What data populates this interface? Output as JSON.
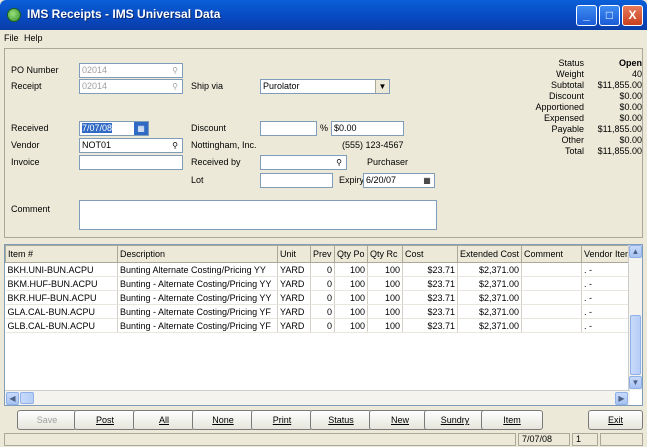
{
  "window": {
    "title": "IMS Receipts - IMS Universal Data",
    "minimize": "_",
    "maximize": "□",
    "close": "X"
  },
  "menu": [
    "File",
    "Help"
  ],
  "form": {
    "po_number_label": "PO Number",
    "po_number": "02014",
    "receipt_label": "Receipt",
    "receipt": "02014",
    "ship_via_label": "Ship via",
    "ship_via": "Purolator",
    "received_label": "Received",
    "received": "7/07/08",
    "discount_label": "Discount",
    "discount_pct": "",
    "pct_sign": "%",
    "discount_amount": "$0.00",
    "vendor_label": "Vendor",
    "vendor": "NOT01",
    "vendor_name": "Nottingham, Inc.",
    "vendor_phone": "(555) 123-4567",
    "invoice_label": "Invoice",
    "invoice": "",
    "received_by_label": "Received by",
    "received_by": "",
    "purchaser_label": "Purchaser",
    "lot_label": "Lot",
    "lot": "",
    "expiry_label": "Expiry",
    "expiry": "6/20/07",
    "comment_label": "Comment",
    "comment": ""
  },
  "summary": [
    {
      "label": "Status",
      "value": "Open",
      "bold": true
    },
    {
      "label": "Weight",
      "value": "40"
    },
    {
      "label": "Subtotal",
      "value": "$11,855.00"
    },
    {
      "label": "Discount",
      "value": "$0.00"
    },
    {
      "label": "Apportioned",
      "value": "$0.00"
    },
    {
      "label": "Expensed",
      "value": "$0.00"
    },
    {
      "label": "Payable",
      "value": "$11,855.00"
    },
    {
      "label": "Other",
      "value": "$0.00"
    },
    {
      "label": "Total",
      "value": "$11,855.00"
    }
  ],
  "grid": {
    "columns": [
      "Item #",
      "Description",
      "Unit",
      "Prev",
      "Qty Po",
      "Qty Rc",
      "Cost",
      "Extended Cost",
      "Comment",
      "Vendor Iten"
    ],
    "rows": [
      [
        "BKH.UNI-BUN.ACPU",
        "Bunting Alternate Costing/Pricing YY",
        "YARD",
        "0",
        "100",
        "100",
        "$23.71",
        "$2,371.00",
        "",
        ". -"
      ],
      [
        "BKM.HUF-BUN.ACPU",
        "Bunting - Alternate Costing/Pricing YY",
        "YARD",
        "0",
        "100",
        "100",
        "$23.71",
        "$2,371.00",
        "",
        ". -"
      ],
      [
        "BKR.HUF-BUN.ACPU",
        "Bunting - Alternate Costing/Pricing YY",
        "YARD",
        "0",
        "100",
        "100",
        "$23.71",
        "$2,371.00",
        "",
        ". -"
      ],
      [
        "GLA.CAL-BUN.ACPU",
        "Bunting - Alternate Costing/Pricing YF",
        "YARD",
        "0",
        "100",
        "100",
        "$23.71",
        "$2,371.00",
        "",
        ". -"
      ],
      [
        "GLB.CAL-BUN.ACPU",
        "Bunting - Alternate Costing/Pricing YF",
        "YARD",
        "0",
        "100",
        "100",
        "$23.71",
        "$2,371.00",
        "",
        ". -"
      ]
    ]
  },
  "buttons": [
    "Save",
    "Post",
    "All",
    "None",
    "Print",
    "Status",
    "New",
    "Sundry",
    "Item",
    "Exit"
  ],
  "status": {
    "date": "7/07/08",
    "page": "1"
  }
}
